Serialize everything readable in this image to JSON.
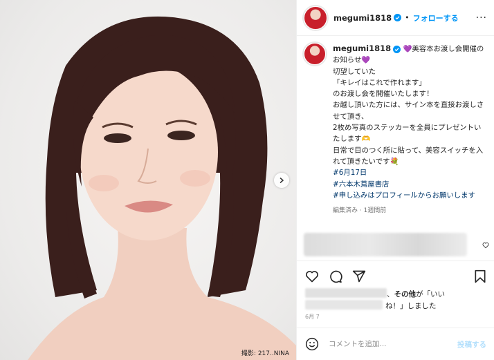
{
  "photo": {
    "credit": "撮影: 217..NINA",
    "next_icon": "chevron-right-icon"
  },
  "header": {
    "username": "megumi1818",
    "dot": "•",
    "follow_label": "フォローする",
    "more_label": "···"
  },
  "caption": {
    "username": "megumi1818",
    "text": " 💜美容本お渡し会開催のお知らせ💜\n切望していた\n「キレイはこれで作れます」\nのお渡し会を開催いたします！\nお越し頂いた方には、サイン本を直接お渡しさせて頂き、\n2枚め写真のステッカーを全員にプレゼントいたします🫶\n日常で目のつく所に貼って、美容スイッチを入れて頂きたいです💐",
    "hashtags": [
      "#6月17日",
      "#六本木蔦屋書店",
      "#申し込みはプロフィールからお願いします"
    ],
    "meta": "編集済み · 1週間前"
  },
  "likes": {
    "others_label": "その他",
    "text_mid": "が「いい",
    "text_end": "ね！」しました"
  },
  "date": "6月 7",
  "comment_input": {
    "placeholder": "コメントを追加...",
    "post_label": "投稿する"
  },
  "colors": {
    "accent": "#0095f6",
    "hashtag": "#00376b",
    "post_disabled": "#b2dffc"
  }
}
